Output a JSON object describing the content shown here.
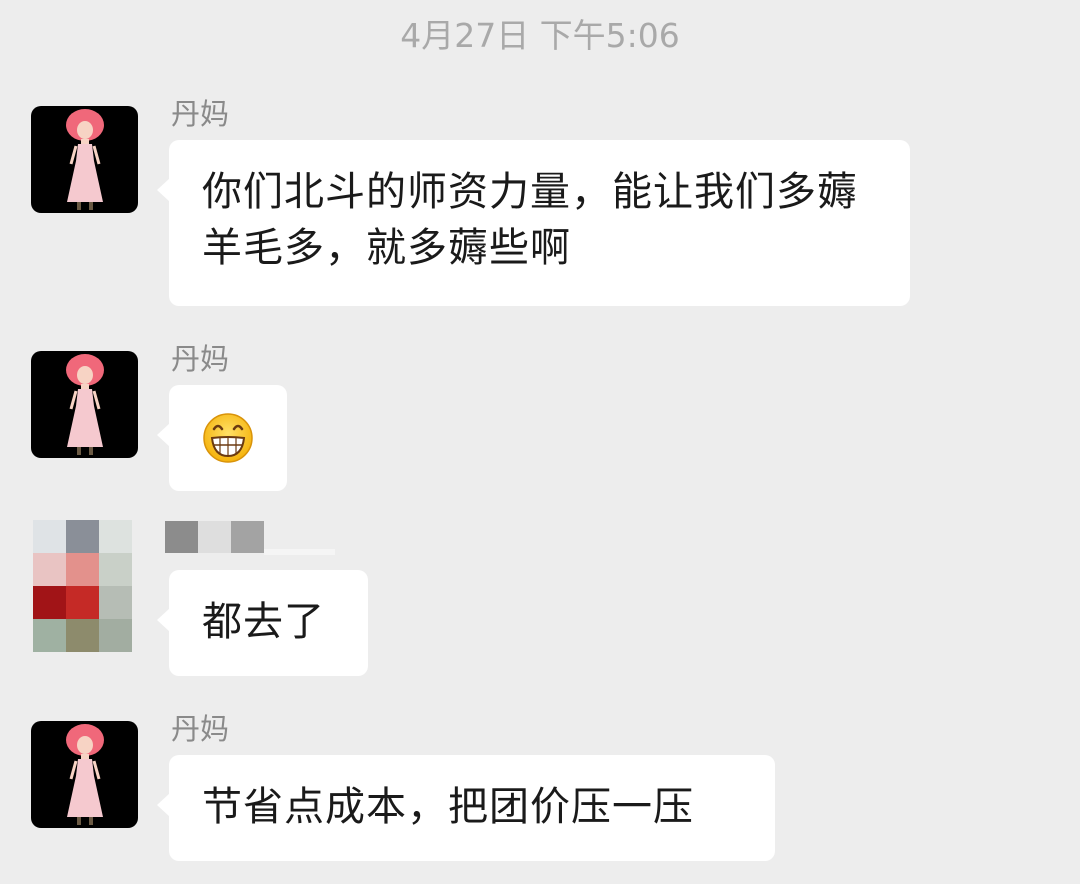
{
  "timestamp": "4月27日 下午5:06",
  "messages": [
    {
      "sender": "丹妈",
      "avatar": "pink-hair-girl-avatar",
      "text": "你们北斗的师资力量，能让我们多薅羊毛多，就多薅些啊"
    },
    {
      "sender": "丹妈",
      "avatar": "pink-hair-girl-avatar",
      "emoji": "grinning-face-icon"
    },
    {
      "sender": "",
      "avatar": "blurred-avatar",
      "text": "都去了"
    },
    {
      "sender": "丹妈",
      "avatar": "pink-hair-girl-avatar",
      "text": "节省点成本，把团价压一压"
    }
  ],
  "colors": {
    "background": "#ededed",
    "bubble": "#ffffff",
    "sender_text": "#8a8a8a",
    "timestamp_text": "#a9a9a9",
    "avatar_hair": "#f0687a",
    "avatar_dress": "#f5c9cf"
  }
}
